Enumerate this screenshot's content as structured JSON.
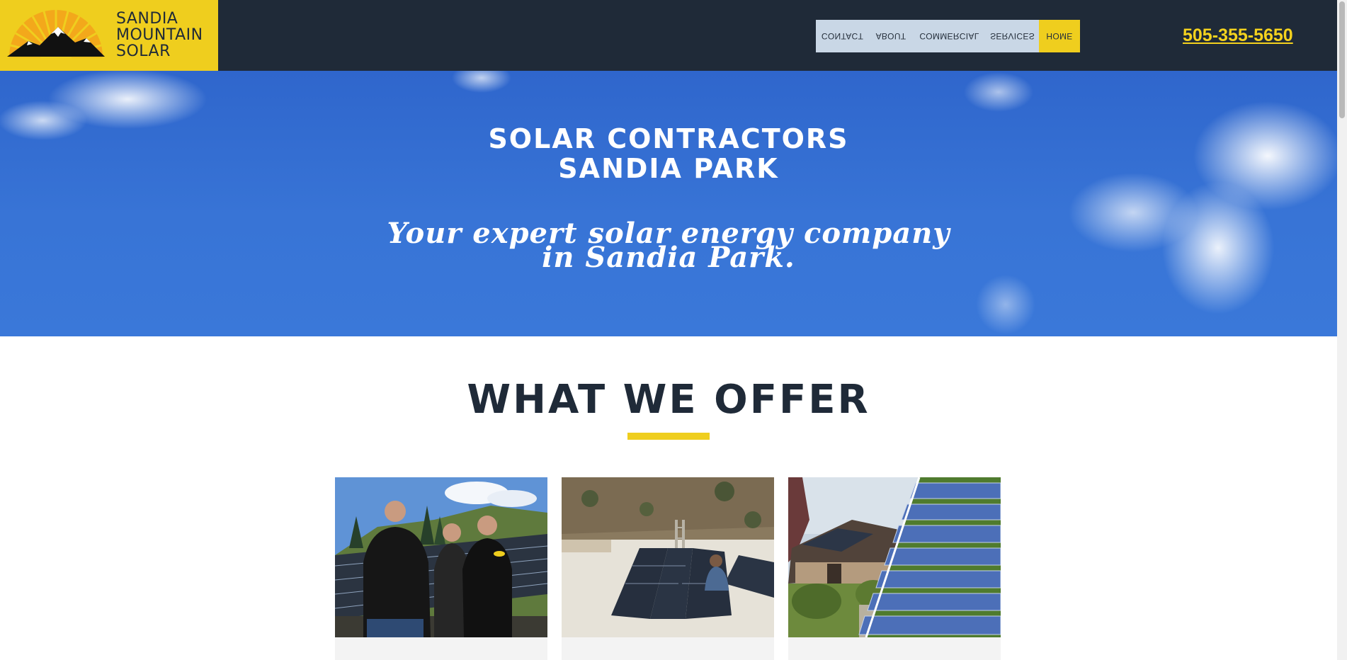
{
  "header": {
    "logo_lines": [
      "SANDIA",
      "MOUNTAIN",
      "SOLAR"
    ],
    "nav": [
      {
        "label": "CONTACT"
      },
      {
        "label": "ABOUT"
      },
      {
        "label": "COMMERCIAL"
      },
      {
        "label": "SERVICES"
      },
      {
        "label": "HOME"
      }
    ],
    "active_nav": "HOME",
    "phone": "505-355-5650"
  },
  "hero": {
    "title_lines": [
      "SOLAR CONTRACTORS",
      "SANDIA PARK"
    ],
    "subtitle_lines": [
      "Your expert solar energy company",
      "in Sandia Park."
    ]
  },
  "offer": {
    "title": "WHAT WE OFFER"
  },
  "colors": {
    "header_bg": "#1f2a38",
    "brand_yellow": "#efce1e",
    "nav_bg": "#c9d7e6",
    "hero_sky": "#3874d6",
    "phone": "#f4d21e"
  },
  "icons": [
    "sun-mountain-logo-icon"
  ]
}
